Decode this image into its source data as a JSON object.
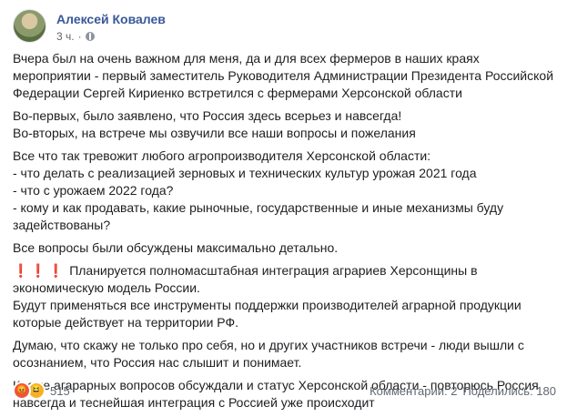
{
  "post": {
    "author": "Алексей Ковалев",
    "time": "3 ч.",
    "separator": "·",
    "paragraphs": [
      [
        "Вчера был на очень важном для меня, да и для всех фермеров в наших краях мероприятии - первый заместитель Руководителя Администрации Президента Российской Федерации Сергей Кириенко встретился с фермерами Херсонской области"
      ],
      [
        "Во-первых, было заявлено, что Россия здесь всерьез и навсегда!",
        "Во-вторых, на встрече мы озвучили все наши вопросы и пожелания"
      ],
      [
        "Все что так тревожит любого агропроизводителя Херсонской области:",
        "- что делать с реализацией зерновых и технических культур урожая 2021 года",
        "- что с урожаем 2022 года?",
        "- кому и как продавать, какие рыночные, государственные и иные механизмы буду задействованы?"
      ],
      [
        "Все вопросы были обсуждены максимально детально."
      ]
    ],
    "highlight": {
      "emoji": "❗❗❗",
      "text": "Планируется полномасштабная интеграция аграриев Херсонщины в экономическую модель России.",
      "followup": "Будут применяться все инструменты поддержки производителей аграрной продукции которые действует на территории РФ."
    },
    "paragraphs_after": [
      [
        "Думаю, что скажу не только про себя, но и других участников встречи - люди вышли с осознанием, что Россия нас слышит и понимает."
      ],
      [
        "Кроме агарарных вопросов обсуждали и статус Херсонской области - повторюсь Россия навсегда и теснейшая интеграция с Россией уже происходит"
      ]
    ]
  },
  "footer": {
    "reaction_icons": [
      "angry-icon",
      "haha-icon"
    ],
    "reaction_count": "515",
    "comments": "Комментарии: 2",
    "shares": "Поделились: 180"
  }
}
